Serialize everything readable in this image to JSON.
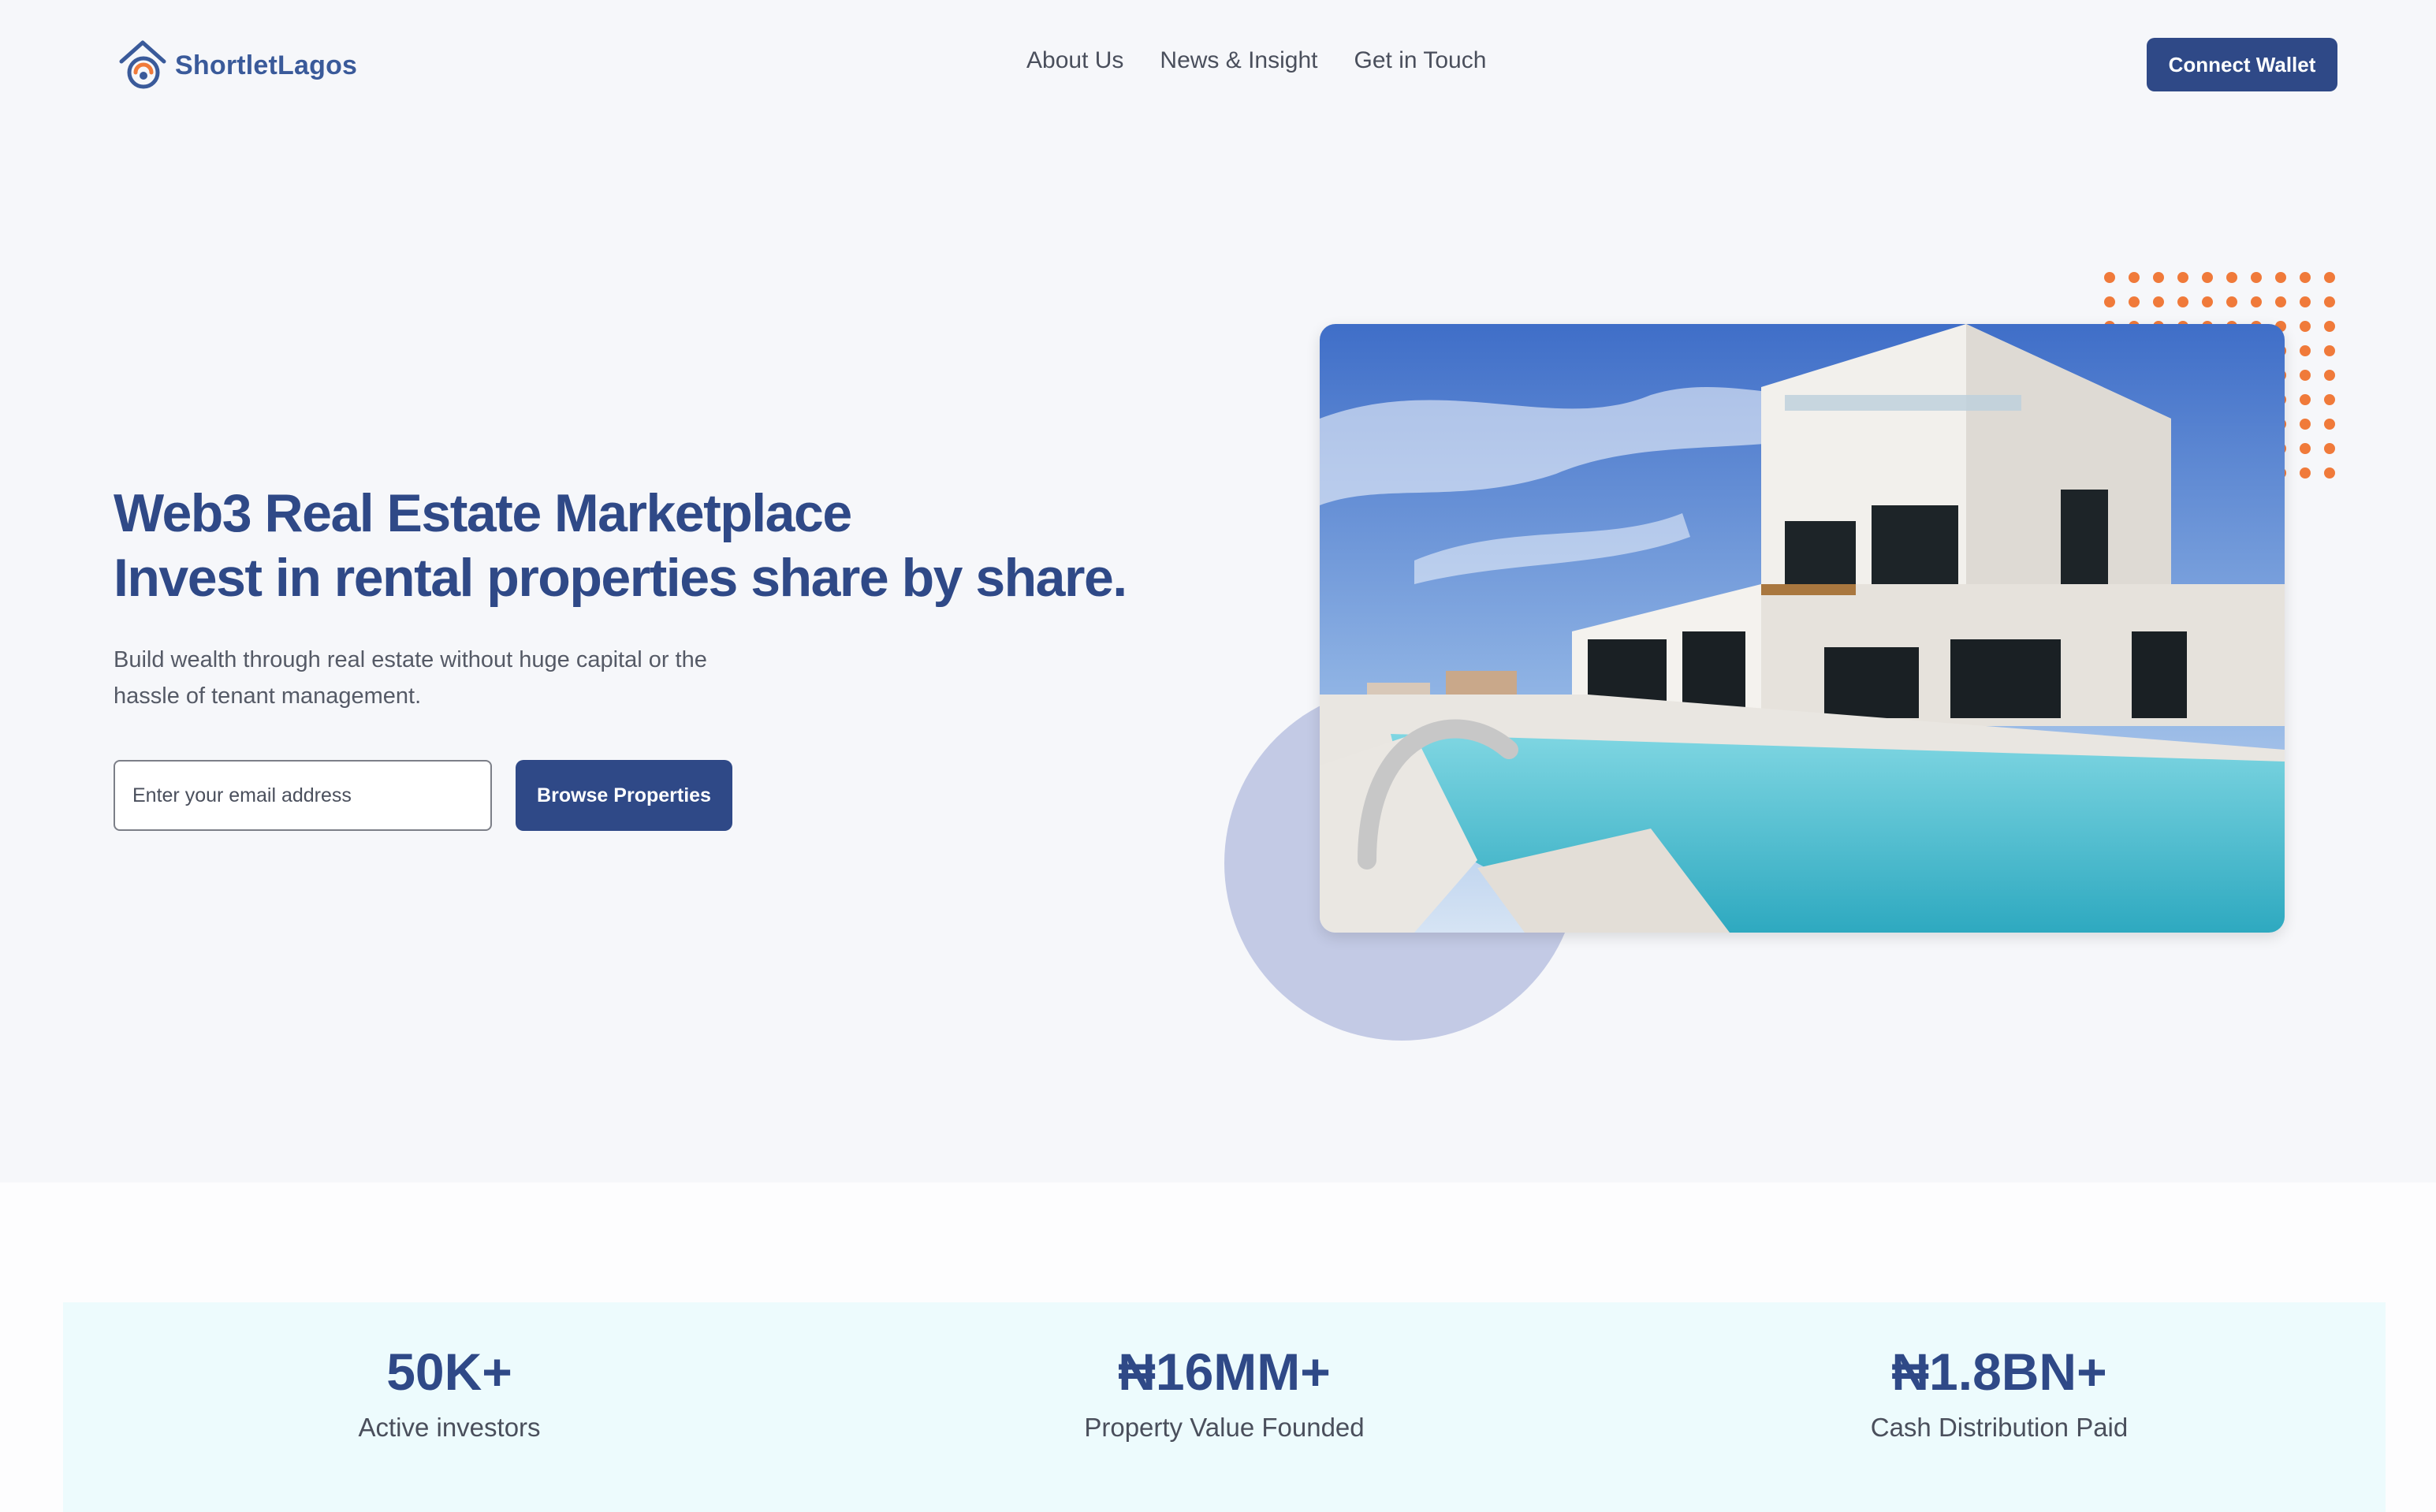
{
  "header": {
    "logo_text": "ShortletLagos",
    "nav": [
      "About Us",
      "News & Insight",
      "Get in Touch"
    ],
    "connect_label": "Connect Wallet"
  },
  "hero": {
    "title_line1": "Web3 Real Estate Marketplace",
    "title_line2": "Invest in rental properties share by share.",
    "subtitle": "Build wealth through real estate without huge capital or the hassle of tenant management.",
    "email_placeholder": "Enter your email address",
    "browse_label": "Browse Properties"
  },
  "stats": [
    {
      "value": "50K+",
      "label": "Active investors"
    },
    {
      "value": "₦16MM+",
      "label": "Property Value Founded"
    },
    {
      "value": "₦1.8BN+",
      "label": "Cash Distribution Paid"
    }
  ],
  "colors": {
    "primary": "#2f4987",
    "accent_orange": "#f07a3a",
    "circle": "#c3cae5",
    "stats_background": "#edfbfd",
    "page_background": "#f6f7fa"
  }
}
